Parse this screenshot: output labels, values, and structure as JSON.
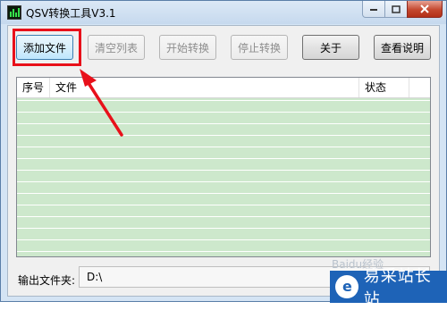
{
  "window": {
    "title": "QSV转换工具V3.1",
    "icons": {
      "minimize": "minimize-icon",
      "maximize": "maximize-icon",
      "close": "close-icon"
    }
  },
  "toolbar": {
    "add_file": "添加文件",
    "clear_list": "清空列表",
    "start_convert": "开始转换",
    "stop_convert": "停止转换",
    "about": "关于",
    "view_help": "查看说明"
  },
  "list": {
    "columns": [
      "序号",
      "文件",
      "状态"
    ],
    "row_colors": {
      "stripe": "#cde8cc",
      "separator": "#ffffff"
    }
  },
  "output": {
    "label": "输出文件夹:",
    "value": "D:\\"
  },
  "annotation": {
    "highlight_color": "#e8101a",
    "arrow_color": "#e8101a"
  },
  "watermark": {
    "text": "Baidu经验",
    "brand": "易采站长站",
    "color": "#1e63b7"
  }
}
